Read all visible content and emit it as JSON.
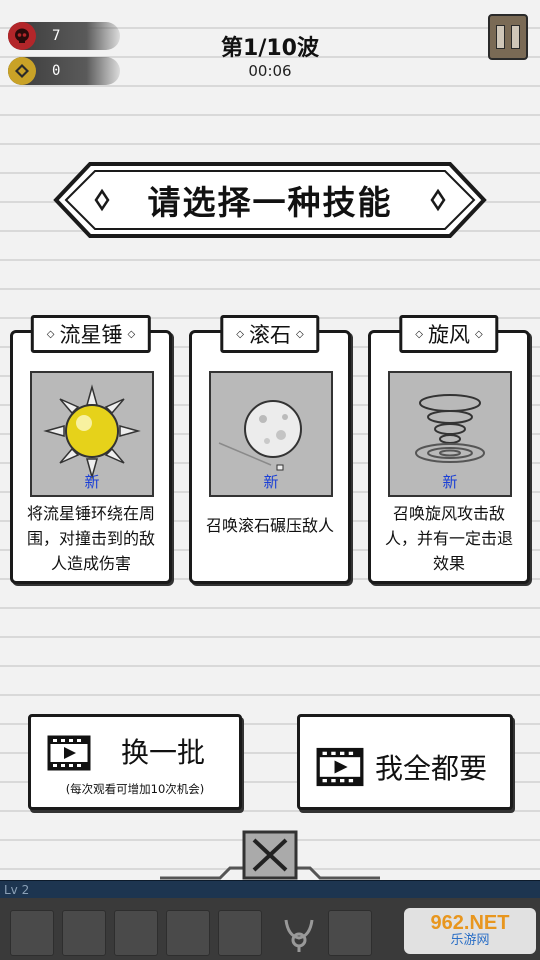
{
  "hud": {
    "kills": "7",
    "coins": "0",
    "wave": "第1/10波",
    "timer": "00:06"
  },
  "banner": {
    "title": "请选择一种技能"
  },
  "skills": [
    {
      "name": "流星锤",
      "new_label": "新",
      "desc": "将流星锤环绕在周围，对撞击到的敌人造成伤害",
      "icon": "spiked-mace-icon"
    },
    {
      "name": "滚石",
      "new_label": "新",
      "desc": "召唤滚石碾压敌人",
      "icon": "rolling-stone-icon"
    },
    {
      "name": "旋风",
      "new_label": "新",
      "desc": "召唤旋风攻击敌人，并有一定击退效果",
      "icon": "tornado-icon"
    }
  ],
  "buttons": {
    "refresh_label": "换一批",
    "refresh_note": "(每次观看可增加10次机会)",
    "take_all_label": "我全都要"
  },
  "level": {
    "label": "Lv 2"
  },
  "watermark": {
    "brand": "962.NET",
    "sub": "乐游网"
  },
  "colors": {
    "new_badge": "#1a3fd6",
    "level_bar": "#1d3550",
    "accent_orange": "#e8961e"
  }
}
